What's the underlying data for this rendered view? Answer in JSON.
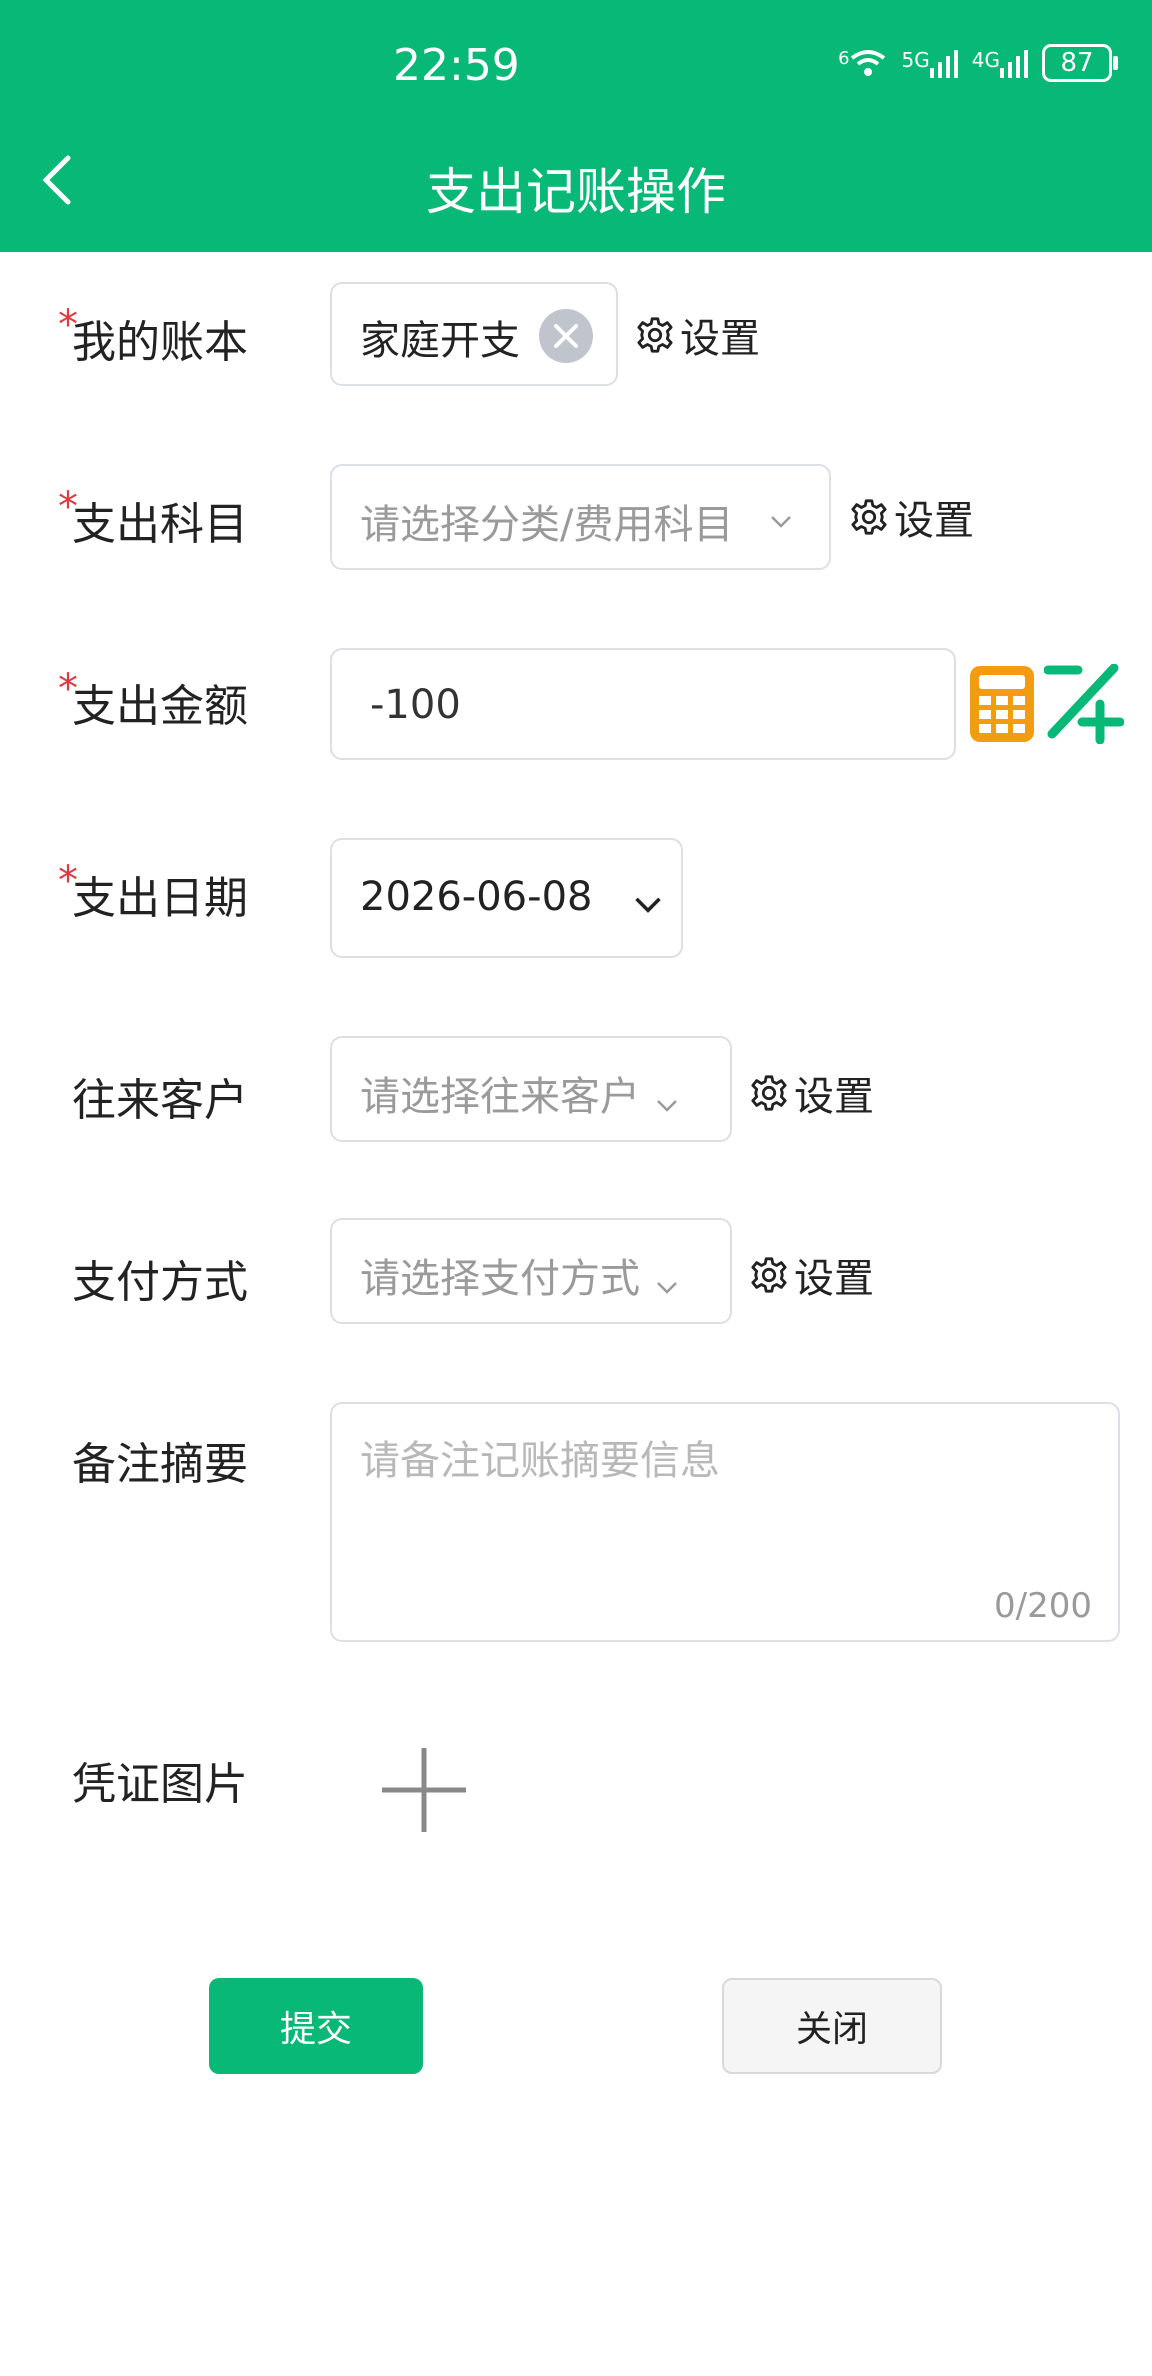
{
  "status_bar": {
    "time": "22:59",
    "wifi_tag": "6",
    "net1": "5G",
    "net2": "4G",
    "battery": "87"
  },
  "header": {
    "title": "支出记账操作"
  },
  "form": {
    "required_mark": "*",
    "account_book": {
      "label": "我的账本",
      "value": "家庭开支",
      "setting": "设置"
    },
    "category": {
      "label": "支出科目",
      "placeholder": "请选择分类/费用科目",
      "setting": "设置"
    },
    "amount": {
      "label": "支出金额",
      "value": "-100"
    },
    "date": {
      "label": "支出日期",
      "value": "2026-06-08"
    },
    "customer": {
      "label": "往来客户",
      "placeholder": "请选择往来客户",
      "setting": "设置"
    },
    "payment": {
      "label": "支付方式",
      "placeholder": "请选择支付方式",
      "setting": "设置"
    },
    "remark": {
      "label": "备注摘要",
      "placeholder": "请备注记账摘要信息",
      "counter": "0/200"
    },
    "voucher": {
      "label": "凭证图片"
    }
  },
  "actions": {
    "submit": "提交",
    "close": "关闭"
  },
  "colors": {
    "brand": "#07b876",
    "calculator": "#f39c12",
    "required": "#e0393e"
  },
  "icons": [
    "back-arrow-icon",
    "gear-icon",
    "clear-icon",
    "chevron-down-icon",
    "calculator-icon",
    "plus-minus-icon",
    "add-image-icon"
  ]
}
